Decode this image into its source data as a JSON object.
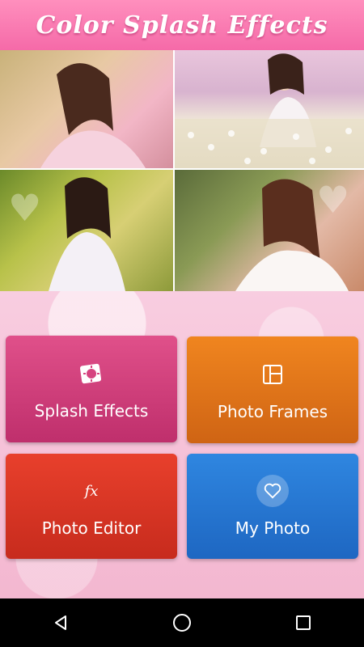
{
  "header": {
    "title": "Color Splash Effects"
  },
  "collage": {
    "photos": [
      {
        "name": "collage-photo-1"
      },
      {
        "name": "collage-photo-2"
      },
      {
        "name": "collage-photo-3"
      },
      {
        "name": "collage-photo-4"
      }
    ]
  },
  "menu": {
    "splash": {
      "label": "Splash Effects",
      "icon": "splash-icon",
      "color": "#d64480"
    },
    "frames": {
      "label": "Photo Frames",
      "icon": "frame-icon",
      "color": "#e6781b"
    },
    "editor": {
      "label": "Photo Editor",
      "icon": "fx-icon",
      "icon_text": "fx",
      "color": "#db3827"
    },
    "myphoto": {
      "label": "My Photo",
      "icon": "heart-icon",
      "color": "#2779d6"
    }
  },
  "navbar": {
    "back": "back-icon",
    "home": "home-icon",
    "recent": "recent-apps-icon"
  }
}
